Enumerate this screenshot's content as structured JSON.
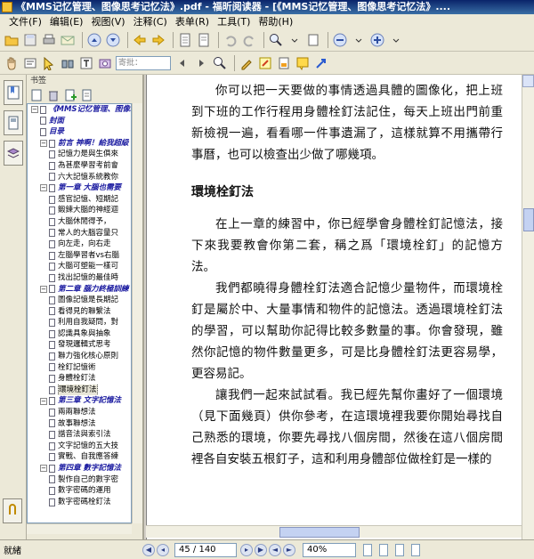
{
  "window": {
    "title": "《MMS记忆管理、图像思考记忆法》.pdf - 福昕阅读器 - [《MMS记忆管理、图像思考记忆法》...."
  },
  "menu": [
    "文件(F)",
    "编辑(E)",
    "视图(V)",
    "注释(C)",
    "表单(R)",
    "工具(T)",
    "帮助(H)"
  ],
  "toolbar2": {
    "page_input_placeholder": "寄批："
  },
  "panel": {
    "header": "书签"
  },
  "bookmarks": [
    {
      "text": "《MMS记忆管理、图像…",
      "level": 0,
      "type": "chapter",
      "expander": "−"
    },
    {
      "text": "封面",
      "level": 1,
      "type": "chapter"
    },
    {
      "text": "目录",
      "level": 1,
      "type": "chapter"
    },
    {
      "text": "前言 神啊！給我超級",
      "level": 1,
      "type": "chapter",
      "expander": "−"
    },
    {
      "text": "記憶力是與生俱來",
      "level": 2,
      "type": "item"
    },
    {
      "text": "為甚麼學習考前會",
      "level": 2,
      "type": "item"
    },
    {
      "text": "六大記憶系統教你",
      "level": 2,
      "type": "item"
    },
    {
      "text": "第一章 大腦也需要",
      "level": 1,
      "type": "chapter",
      "expander": "−"
    },
    {
      "text": "感官記憶、短期記",
      "level": 2,
      "type": "item"
    },
    {
      "text": "鍛鍊大腦的神經迴",
      "level": 2,
      "type": "item"
    },
    {
      "text": "大腦休閒得予，",
      "level": 2,
      "type": "item"
    },
    {
      "text": "常人的大腦容量只",
      "level": 2,
      "type": "item"
    },
    {
      "text": "向左走，向右走",
      "level": 2,
      "type": "item"
    },
    {
      "text": "左腦學習者vs右腦",
      "level": 2,
      "type": "item"
    },
    {
      "text": "大腦可塑能一樣可",
      "level": 2,
      "type": "item"
    },
    {
      "text": "找出記憶的最佳時",
      "level": 2,
      "type": "item"
    },
    {
      "text": "第二章 腦力終極訓練",
      "level": 1,
      "type": "chapter",
      "expander": "−"
    },
    {
      "text": "圖像記憶是長期記",
      "level": 2,
      "type": "item"
    },
    {
      "text": "看得見的聯繫法",
      "level": 2,
      "type": "item"
    },
    {
      "text": "利用自我疑問，對",
      "level": 2,
      "type": "item"
    },
    {
      "text": "認識具象與抽象",
      "level": 2,
      "type": "item"
    },
    {
      "text": "發現邏輯式思考",
      "level": 2,
      "type": "item"
    },
    {
      "text": "聯力強化核心原則",
      "level": 2,
      "type": "item"
    },
    {
      "text": "栓釘記憶術",
      "level": 2,
      "type": "item"
    },
    {
      "text": "身體栓釘法",
      "level": 2,
      "type": "item"
    },
    {
      "text": "環境栓釘法",
      "level": 2,
      "type": "item",
      "selected": true
    },
    {
      "text": "第三章 文字記憶法",
      "level": 1,
      "type": "chapter",
      "expander": "−"
    },
    {
      "text": "兩兩聯想法",
      "level": 2,
      "type": "item"
    },
    {
      "text": "故事聯想法",
      "level": 2,
      "type": "item"
    },
    {
      "text": "諧音法與索引法",
      "level": 2,
      "type": "item"
    },
    {
      "text": "文字記憶的五大技",
      "level": 2,
      "type": "item"
    },
    {
      "text": "實戰、自我應答練",
      "level": 2,
      "type": "item"
    },
    {
      "text": "第四章 數字記憶法",
      "level": 1,
      "type": "chapter",
      "expander": "−"
    },
    {
      "text": "製作自己的數字密",
      "level": 2,
      "type": "item"
    },
    {
      "text": "數字密碼的運用",
      "level": 2,
      "type": "item"
    },
    {
      "text": "數字密碼栓釘法",
      "level": 2,
      "type": "item"
    }
  ],
  "document": {
    "para1": "你可以把一天要做的事情透過具體的圖像化，把上班到下班的工作行程用身體栓釘法記住，每天上班出門前重新檢視一遍，看看哪一件事遺漏了，這樣就算不用攜帶行事曆，也可以檢查出少做了哪幾項。",
    "heading": "環境栓釘法",
    "para2": "在上一章的練習中，你已經學會身體栓釘記憶法，接下來我要教會你第二套，稱之爲「環境栓釘」的記憶方法。",
    "para3": "我們都曉得身體栓釘法適合記憶少量物件，而環境栓釘是屬於中、大量事情和物件的記憶法。透過環境栓釘法的學習，可以幫助你記得比較多數量的事。你會發現，雖然你記憶的物件數量更多，可是比身體栓釘法更容易學，更容易記。",
    "para4": "讓我們一起來試試看。我已經先幫你畫好了一個環境（見下面幾頁）供你參考，在這環境裡我要你開始尋找自己熟悉的環境，你要先尋找八個房間，然後在這八個房間裡各自安裝五根釘子，這和利用身體部位做栓釘是一樣的"
  },
  "status": {
    "text": "就緒",
    "page": "45 / 140",
    "zoom": "40%"
  }
}
